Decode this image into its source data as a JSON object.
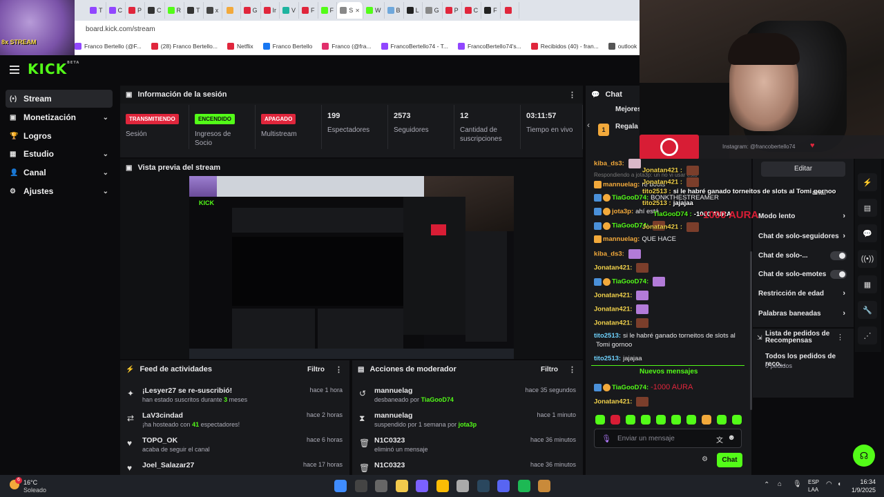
{
  "browser": {
    "tabs": [
      "T",
      "C",
      "P",
      "C",
      "R",
      "T",
      "x",
      "",
      "G",
      "Ir",
      "V",
      "F",
      "F",
      "S",
      "W",
      "B",
      "L",
      "G",
      "P",
      "C",
      "F",
      ""
    ],
    "url": "board.kick.com/stream",
    "bookmarks": [
      "Franco Bertello (@F...",
      "(28) Franco Bertello...",
      "Netflix",
      "Franco Bertello",
      "Franco (@fra...",
      "FrancoBertello74 - T...",
      "FrancoBertello74's...",
      "Recibidos (40) - fran...",
      "outlook",
      "Aler"
    ],
    "thumb_text": "8x STREAM"
  },
  "header": {
    "logo": "KICK",
    "beta": "BETA"
  },
  "sidebar": {
    "items": [
      {
        "label": "Stream",
        "icon": "(•)"
      },
      {
        "label": "Monetización",
        "icon": "▣"
      },
      {
        "label": "Logros",
        "icon": "🏆"
      },
      {
        "label": "Estudio",
        "icon": "▦"
      },
      {
        "label": "Canal",
        "icon": "👤"
      },
      {
        "label": "Ajustes",
        "icon": "⚙"
      }
    ]
  },
  "session": {
    "title": "Información de la sesión",
    "stats": [
      {
        "badge": "TRANSMITIENDO",
        "label": "Sesión"
      },
      {
        "badge": "ENCENDIDO",
        "label": "Ingresos de Socio"
      },
      {
        "badge": "APAGADO",
        "label": "Multistream"
      },
      {
        "value": "199",
        "label": "Espectadores"
      },
      {
        "value": "2573",
        "label": "Seguidores"
      },
      {
        "value": "12",
        "label": "Cantidad de suscripciones"
      },
      {
        "value": "03:11:57",
        "label": "Tiempo en vivo"
      }
    ]
  },
  "preview": {
    "title": "Vista previa del stream"
  },
  "activity": {
    "title": "Feed de actividades",
    "filter": "Filtro",
    "items": [
      {
        "name": "¡Lesyer27 se re-suscribió!",
        "pre": "han estado suscritos durante ",
        "hl": "3",
        "post": " meses",
        "time": "hace 1 hora",
        "icon": "✦"
      },
      {
        "name": "LaV3cindad",
        "pre": "¡ha hosteado con ",
        "hl": "41",
        "post": " espectadores!",
        "time": "hace 2 horas",
        "icon": "⇄"
      },
      {
        "name": "TOPO_OK",
        "pre": "acaba de seguir el canal",
        "hl": "",
        "post": "",
        "time": "hace 6 horas",
        "icon": "♥"
      },
      {
        "name": "Joel_Salazar27",
        "pre": "",
        "hl": "",
        "post": "",
        "time": "hace 17 horas",
        "icon": "♥"
      }
    ]
  },
  "modactions": {
    "title": "Acciones de moderador",
    "filter": "Filtro",
    "items": [
      {
        "name": "mannuelag",
        "pre": "desbaneado por ",
        "hl": "TiaGooD74",
        "time": "hace 35 segundos",
        "icon": "↺"
      },
      {
        "name": "mannuelag",
        "pre": "suspendido por 1 semana por ",
        "hl": "jota3p",
        "time": "hace 1 minuto",
        "icon": "⧗"
      },
      {
        "name": "N1C0323",
        "pre": "eliminó un mensaje",
        "hl": "",
        "time": "hace 36 minutos",
        "icon": "🗑"
      },
      {
        "name": "N1C0323",
        "pre": "",
        "hl": "",
        "time": "hace 36 minutos",
        "icon": "🗑"
      }
    ]
  },
  "chat": {
    "title": "Chat",
    "top_label": "Mejores",
    "gift_label": "Regala 1",
    "reply_note": "Respondiendo a jota3p: un no vi usar esto",
    "new_messages": "Nuevos mensajes",
    "input_placeholder": "Enviar un mensaje",
    "send_label": "Chat",
    "messages": [
      {
        "user": "kiba_ds3:",
        "text": "",
        "color": "#f2a93b"
      },
      {
        "user": "mannuelag:",
        "text": "re bools",
        "color": "#f2a93b"
      },
      {
        "user": "TiaGooD74:",
        "text": "BONKTHESTREAMER",
        "color": "#53fc18"
      },
      {
        "user": "jota3p:",
        "text": "ahí está",
        "color": "#f2a93b"
      },
      {
        "user": "TiaGooD74:",
        "text": "",
        "color": "#53fc18"
      },
      {
        "user": "mannuelag:",
        "text": "QUE HACE",
        "color": "#f2a93b"
      },
      {
        "user": "kiba_ds3:",
        "text": "",
        "color": "#f2a93b"
      },
      {
        "user": "Jonatan421:",
        "text": "",
        "color": "#f2d24b"
      },
      {
        "user": "TiaGooD74:",
        "text": "",
        "color": "#53fc18"
      },
      {
        "user": "Jonatan421:",
        "text": "",
        "color": "#f2d24b"
      },
      {
        "user": "Jonatan421:",
        "text": "",
        "color": "#f2d24b"
      },
      {
        "user": "Jonatan421:",
        "text": "",
        "color": "#f2d24b"
      },
      {
        "user": "tito2513:",
        "text": "si le habré ganado torneitos de slots al",
        "color": "#6fd3ff"
      },
      {
        "user": "",
        "text": "Tomi gornoo",
        "color": "#6fd3ff"
      },
      {
        "user": "tito2513:",
        "text": "jajajaa",
        "color": "#6fd3ff"
      },
      {
        "user": "TiaGooD74:",
        "text": "-1000 AURA",
        "color": "#53fc18"
      },
      {
        "user": "Jonatan421:",
        "text": "",
        "color": "#f2d24b"
      }
    ]
  },
  "overlay": {
    "instagram": "Instagram: @francobertello74",
    "lines": [
      {
        "user": "Jonatan421 :",
        "text": ""
      },
      {
        "user": "Jonatan421 :",
        "text": ""
      },
      {
        "user": "tito2513 :",
        "text": "si le habré ganado torneitos de slots al Tomi gornoo"
      },
      {
        "user": "tito2513 :",
        "text": "jajajaa"
      },
      {
        "user": "TiaGooD74 :",
        "text": "-1000 AURA"
      },
      {
        "user": "Jonatan421 :",
        "text": ""
      }
    ],
    "behind_text": "Modo lento",
    "behind_text2": "anal"
  },
  "settings": {
    "edit_label": "Editar",
    "items": [
      {
        "label": "Modo lento",
        "kind": "chevron"
      },
      {
        "label": "Chat de solo-seguidores",
        "kind": "chevron"
      },
      {
        "label": "Chat de solo-...",
        "kind": "toggle"
      },
      {
        "label": "Chat de solo-emotes",
        "kind": "toggle"
      },
      {
        "label": "Restricción de edad",
        "kind": "chevron"
      },
      {
        "label": "Palabras baneadas",
        "kind": "chevron"
      }
    ],
    "requests_title": "Lista de pedidos de Recompensas",
    "requests_all": "Todos los pedidos de reco...",
    "requests_count": "0 pedidos"
  },
  "taskbar": {
    "weather_temp": "16°C",
    "weather_text": "Soleado",
    "notif": "6",
    "lang1": "ESP",
    "lang2": "LAA",
    "time": "16:34",
    "date": "1/9/2025"
  },
  "colors": {
    "accent": "#53fc18",
    "live": "#e91e63",
    "panel": "#18191c"
  }
}
